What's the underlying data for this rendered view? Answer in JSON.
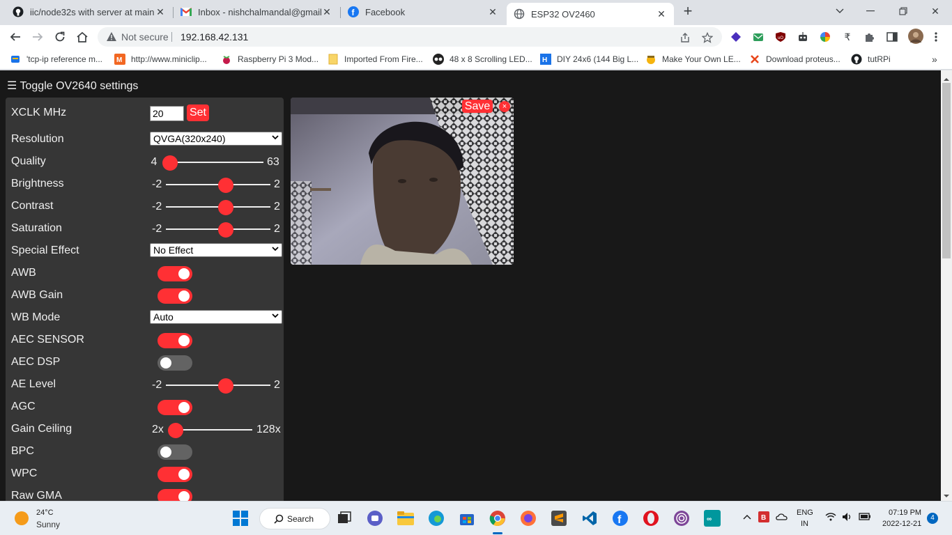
{
  "browser": {
    "tabs": [
      {
        "title": "iic/node32s with server at main ·",
        "favicon": "github-icon",
        "active": false
      },
      {
        "title": "Inbox - nishchalmandal@gmail.co",
        "favicon": "gmail-icon",
        "active": false
      },
      {
        "title": "Facebook",
        "favicon": "facebook-icon",
        "active": false
      },
      {
        "title": "ESP32 OV2460",
        "favicon": "globe-icon",
        "active": true
      }
    ],
    "address": {
      "security": "Not secure",
      "url": "192.168.42.131"
    },
    "bookmarks": [
      {
        "label": "'tcp-ip reference m...",
        "icon": "bookmark-icon"
      },
      {
        "label": "http://www.miniclip...",
        "icon": "miniclip-icon"
      },
      {
        "label": "Raspberry Pi 3 Mod...",
        "icon": "raspberry-icon"
      },
      {
        "label": "Imported From Fire...",
        "icon": "folder-icon"
      },
      {
        "label": "48 x 8 Scrolling LED...",
        "icon": "instructables-icon"
      },
      {
        "label": "DIY 24x6 (144 Big L...",
        "icon": "hackaday-icon"
      },
      {
        "label": "Make Your Own LE...",
        "icon": "maker-icon"
      },
      {
        "label": "Download proteus...",
        "icon": "x-icon"
      },
      {
        "label": "tutRPi",
        "icon": "github-icon"
      }
    ]
  },
  "page": {
    "toggle_label": "☰ Toggle OV2640 settings",
    "xclk": {
      "label": "XCLK MHz",
      "value": "20",
      "button": "Set"
    },
    "resolution": {
      "label": "Resolution",
      "selected": "QVGA(320x240)"
    },
    "quality": {
      "label": "Quality",
      "min": "4",
      "max": "63",
      "value": 4
    },
    "brightness": {
      "label": "Brightness",
      "min": "-2",
      "max": "2",
      "value": 0
    },
    "contrast": {
      "label": "Contrast",
      "min": "-2",
      "max": "2",
      "value": 0
    },
    "saturation": {
      "label": "Saturation",
      "min": "-2",
      "max": "2",
      "value": 0
    },
    "special_effect": {
      "label": "Special Effect",
      "selected": "No Effect"
    },
    "awb": {
      "label": "AWB",
      "on": true
    },
    "awb_gain": {
      "label": "AWB Gain",
      "on": true
    },
    "wb_mode": {
      "label": "WB Mode",
      "selected": "Auto"
    },
    "aec_sensor": {
      "label": "AEC SENSOR",
      "on": true
    },
    "aec_dsp": {
      "label": "AEC DSP",
      "on": false
    },
    "ae_level": {
      "label": "AE Level",
      "min": "-2",
      "max": "2",
      "value": 0
    },
    "agc": {
      "label": "AGC",
      "on": true
    },
    "gain_ceiling": {
      "label": "Gain Ceiling",
      "min": "2x",
      "max": "128x",
      "value": 0
    },
    "bpc": {
      "label": "BPC",
      "on": false
    },
    "wpc": {
      "label": "WPC",
      "on": true
    },
    "raw_gma": {
      "label": "Raw GMA",
      "on": true
    },
    "stream": {
      "save_label": "Save",
      "close_label": "×"
    }
  },
  "taskbar": {
    "weather": {
      "temp": "24°C",
      "condition": "Sunny"
    },
    "search_label": "Search",
    "lang_top": "ENG",
    "lang_bottom": "IN",
    "time": "07:19 PM",
    "date": "2022-12-21",
    "notifications": "4"
  },
  "colors": {
    "accent": "#ff3034",
    "panel": "#363636",
    "page_bg": "#181818"
  }
}
